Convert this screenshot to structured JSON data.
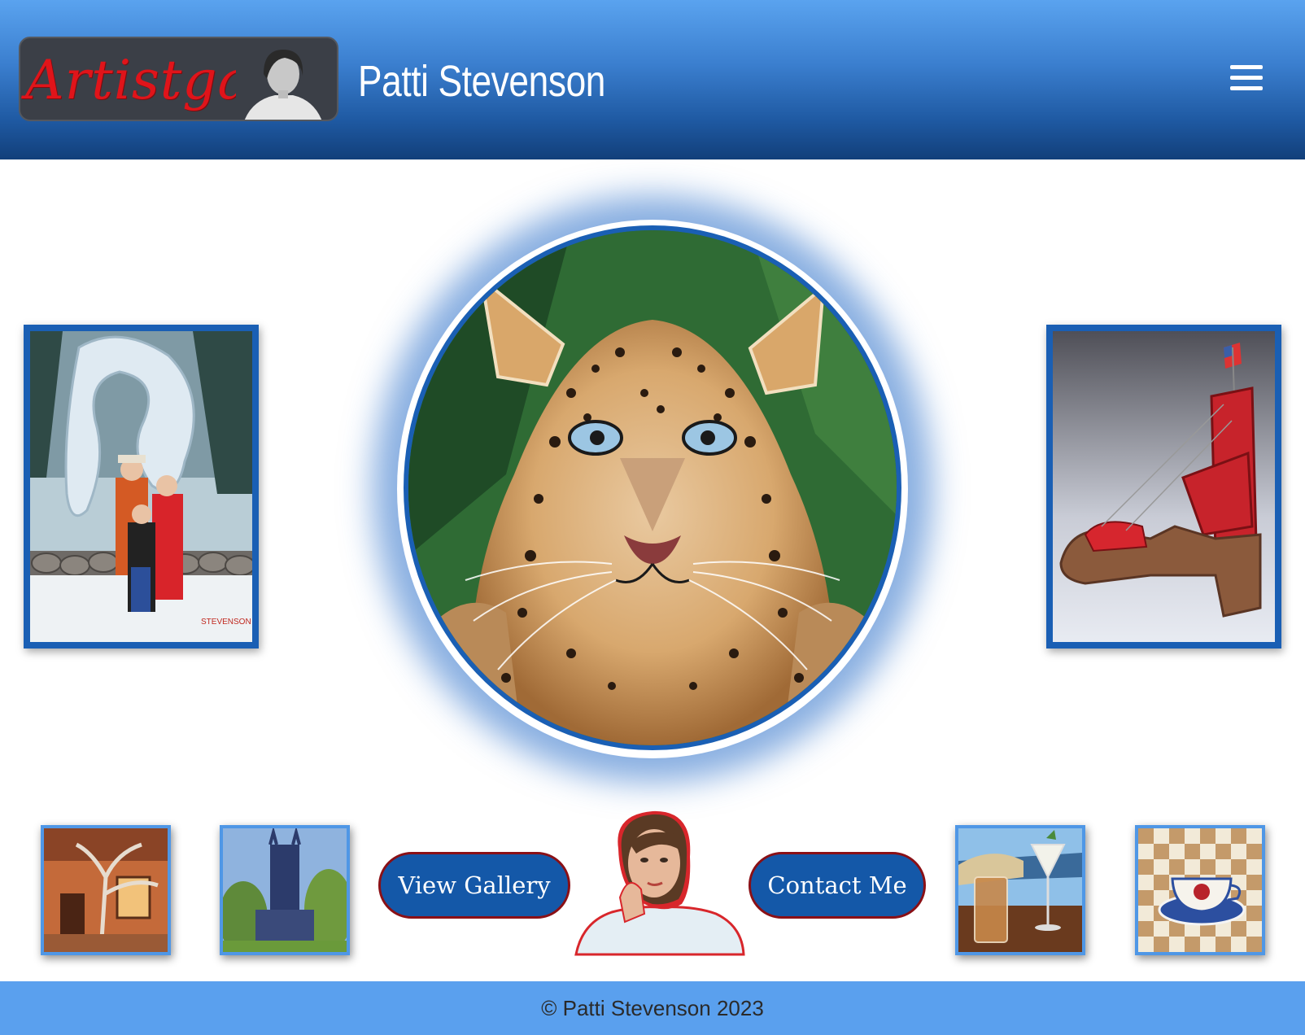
{
  "header": {
    "logo_text": "Artistgal",
    "site_title": "Patti Stevenson",
    "menu_icon": "hamburger-menu-icon"
  },
  "hero": {
    "subject": "leopard-painting"
  },
  "side_paintings": {
    "left": "family-ice-sculpture-painting",
    "right": "red-platform-shoe-sculpture"
  },
  "bottom_bar": {
    "thumbnails_left": [
      "courtyard-tree-painting",
      "chapel-tower-painting"
    ],
    "thumbnails_right": [
      "drinks-by-lake-painting",
      "teacup-checkerboard-painting"
    ],
    "view_gallery_label": "View Gallery",
    "contact_label": "Contact Me",
    "center_portrait": "artist-portrait"
  },
  "footer": {
    "copyright": "© Patti Stevenson 2023"
  },
  "colors": {
    "header_top": "#5aa3ef",
    "header_bottom": "#123f7a",
    "frame_blue": "#1a5fb4",
    "button_blue": "#1458a8",
    "button_border": "#8a1016",
    "footer_bg": "#5aa0ee"
  }
}
